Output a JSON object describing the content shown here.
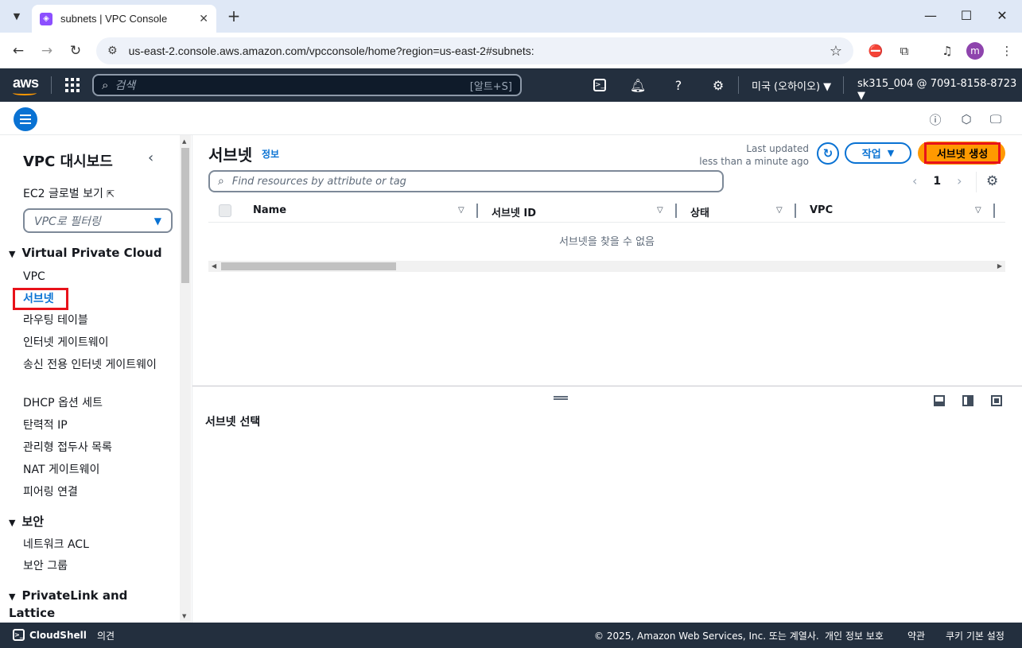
{
  "browser": {
    "tab_title": "subnets | VPC Console",
    "url": "us-east-2.console.aws.amazon.com/vpcconsole/home?region=us-east-2#subnets:",
    "profile_initial": "m"
  },
  "aws_nav": {
    "logo": "aws",
    "search_placeholder": "검색",
    "search_shortcut": "[알트+S]",
    "region": "미국 (오하이오) ▼",
    "account": "sk315_004 @ 7091-8158-8723 ▼"
  },
  "sidebar": {
    "title": "VPC 대시보드",
    "ec2_global": "EC2 글로벌 보기",
    "vpc_filter_placeholder": "VPC로 필터링",
    "sections": [
      {
        "title": "Virtual Private Cloud",
        "items": [
          "VPC",
          "서브넷",
          "라우팅 테이블",
          "인터넷 게이트웨이",
          "송신 전용 인터넷 게이트웨이",
          "DHCP 옵션 세트",
          "탄력적 IP",
          "관리형 접두사 목록",
          "NAT 게이트웨이",
          "피어링 연결"
        ]
      },
      {
        "title": "보안",
        "items": [
          "네트워크 ACL",
          "보안 그룹"
        ]
      },
      {
        "title": "PrivateLink and Lattice",
        "items": []
      }
    ]
  },
  "main": {
    "title": "서브넷",
    "info": "정보",
    "last_updated_label": "Last updated",
    "last_updated_value": "less than a minute ago",
    "actions_label": "작업",
    "create_label": "서브넷 생성",
    "filter_placeholder": "Find resources by attribute or tag",
    "page_number": "1",
    "columns": [
      "Name",
      "서브넷 ID",
      "상태",
      "VPC"
    ],
    "empty_message": "서브넷을 찾을 수 없음"
  },
  "split_panel": {
    "title": "서브넷 선택"
  },
  "footer": {
    "cloudshell": "CloudShell",
    "feedback": "의견",
    "copyright": "© 2025, Amazon Web Services, Inc. 또는 계열사.",
    "privacy": "개인 정보 보호",
    "terms": "약관",
    "cookies": "쿠키 기본 설정"
  },
  "colors": {
    "aws_nav_bg": "#232f3e",
    "link_blue": "#0972d3",
    "primary_orange": "#ff9900",
    "highlight_red": "#e8121a"
  }
}
